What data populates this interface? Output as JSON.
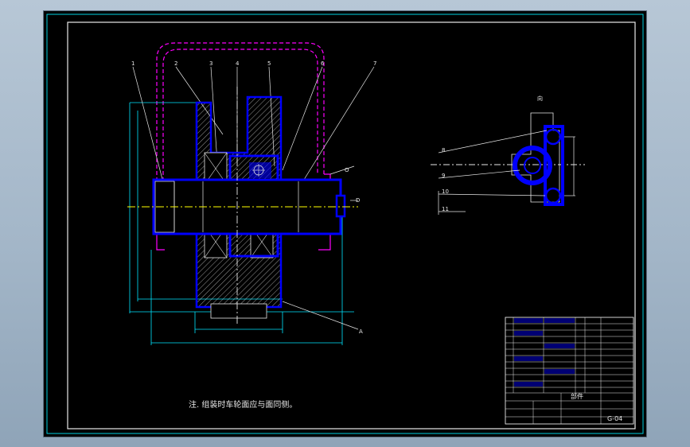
{
  "drawing": {
    "part_labels": [
      "1",
      "2",
      "3",
      "4",
      "5",
      "6",
      "7"
    ],
    "side_labels": [
      "8",
      "9",
      "10",
      "11"
    ],
    "label_A": "A",
    "label_D": "D",
    "label_O": "O",
    "view_label": "向",
    "note": "注. 组装时车轮面应与面同侧。"
  },
  "title_block": {
    "name": "部件",
    "drawing_no": "G-04"
  },
  "colors": {
    "background": "#000000",
    "frame": "#00ffff",
    "part": "#0000ff",
    "outline": "#ff00ff",
    "center_line": "#ffff00"
  }
}
